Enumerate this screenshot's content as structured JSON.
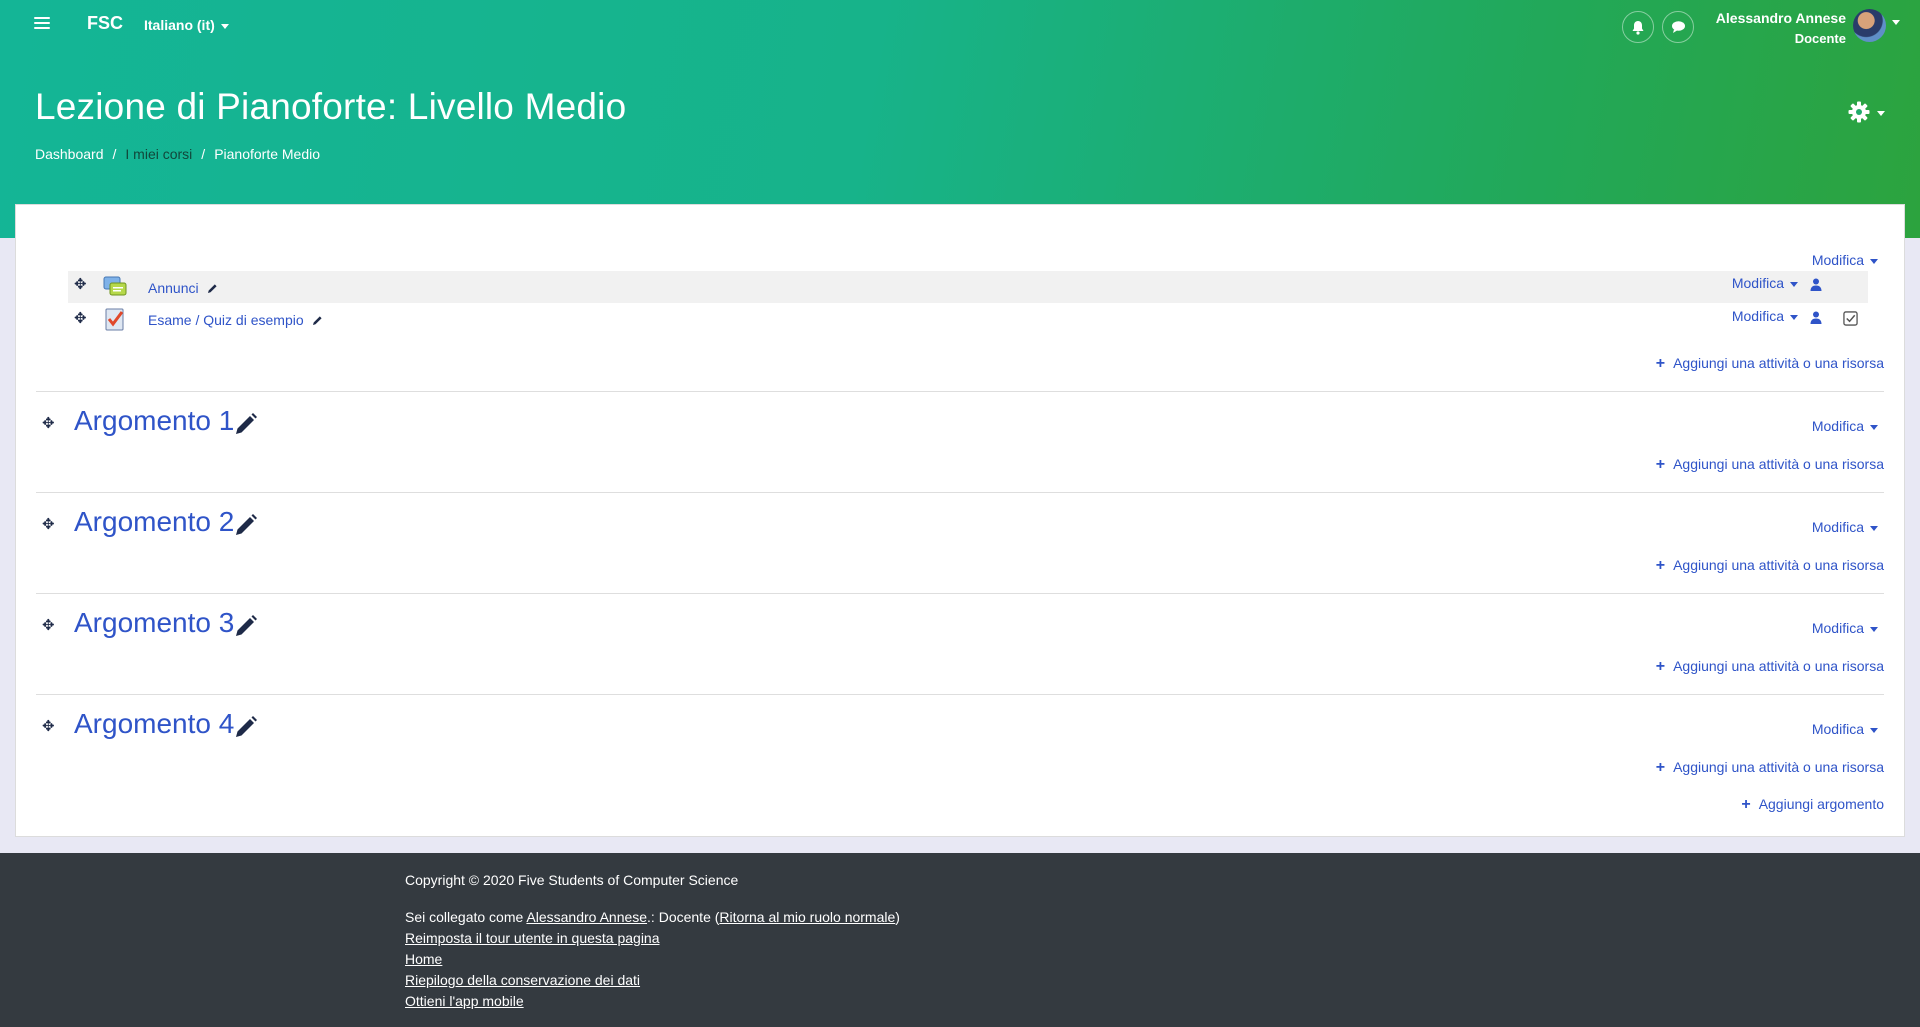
{
  "navbar": {
    "brand": "FSC",
    "language": "Italiano (it)",
    "user_name": "Alessandro Annese",
    "user_role": "Docente"
  },
  "header": {
    "title": "Lezione di Pianoforte: Livello Medio",
    "breadcrumb": [
      "Dashboard",
      "I miei corsi",
      "Pianoforte Medio"
    ]
  },
  "section0": {
    "edit_label": "Modifica",
    "activities": [
      {
        "name": "Annunci",
        "edit_label": "Modifica",
        "icon": "forum-icon"
      },
      {
        "name": "Esame / Quiz di esempio",
        "edit_label": "Modifica",
        "icon": "quiz-icon"
      }
    ],
    "add_label": "Aggiungi una attività o una risorsa"
  },
  "sections": [
    {
      "title": "Argomento 1",
      "edit_label": "Modifica",
      "add_label": "Aggiungi una attività o una risorsa"
    },
    {
      "title": "Argomento 2",
      "edit_label": "Modifica",
      "add_label": "Aggiungi una attività o una risorsa"
    },
    {
      "title": "Argomento 3",
      "edit_label": "Modifica",
      "add_label": "Aggiungi una attività o una risorsa"
    },
    {
      "title": "Argomento 4",
      "edit_label": "Modifica",
      "add_label": "Aggiungi una attività o una risorsa"
    }
  ],
  "add_topic_label": "Aggiungi argomento",
  "footer": {
    "copyright": "Copyright © 2020 Five Students of Computer Science",
    "logged_prefix": "Sei collegato come ",
    "logged_user": "Alessandro Annese",
    "logged_mid": ".: Docente (",
    "logged_role_link": "Ritorna al mio ruolo normale",
    "logged_suffix": ")",
    "links": [
      "Reimposta il tour utente in questa pagina",
      "Home",
      "Riepilogo della conservazione dei dati",
      "Ottieni l'app mobile"
    ]
  },
  "colors": {
    "accent": "#2f54c8",
    "header_start": "#14b596",
    "header_end": "#2ca33e",
    "footer_bg": "#343a40"
  }
}
